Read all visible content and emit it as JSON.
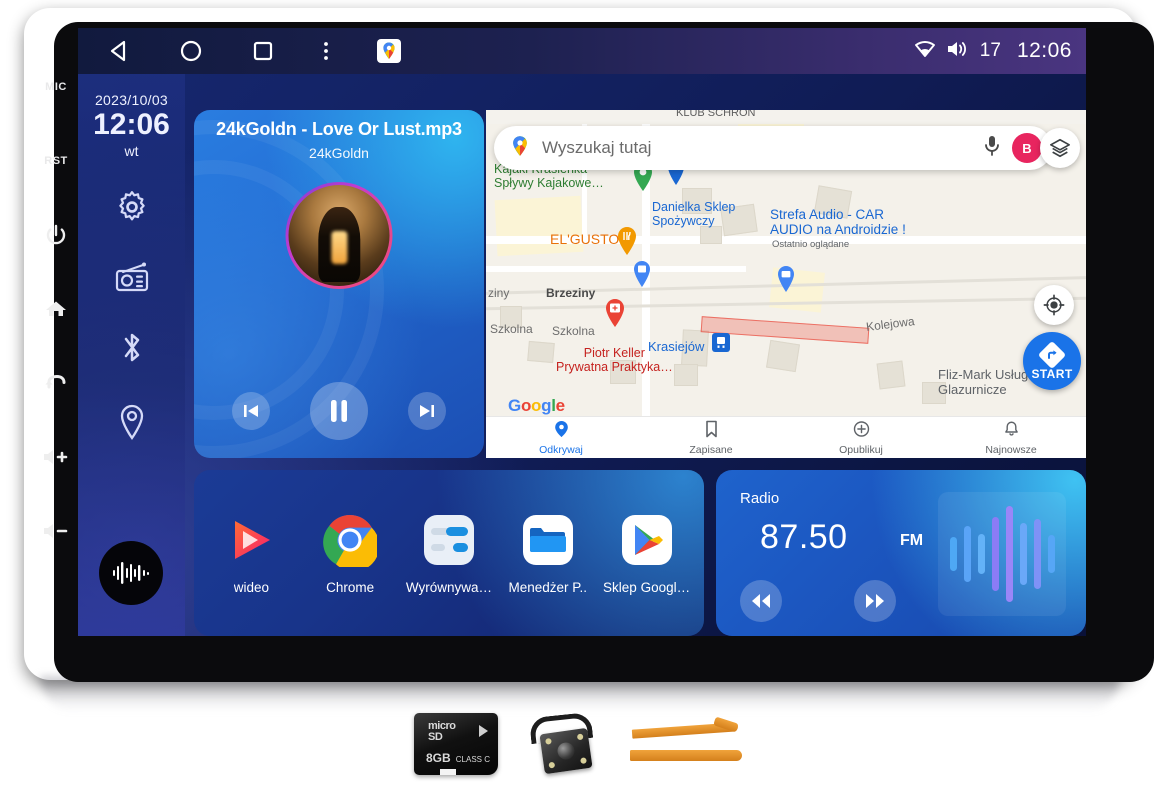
{
  "device": {
    "hardware_buttons": [
      {
        "name": "mic-button",
        "label": "MIC"
      },
      {
        "name": "reset-button",
        "label": "RST"
      },
      {
        "name": "power-button",
        "label": ""
      },
      {
        "name": "home-button",
        "label": ""
      },
      {
        "name": "back-button",
        "label": ""
      },
      {
        "name": "volume-up-button",
        "label": ""
      },
      {
        "name": "volume-down-button",
        "label": ""
      }
    ]
  },
  "statusbar": {
    "nav": [
      "back-icon",
      "home-icon",
      "recents-icon",
      "overflow-icon",
      "maps-icon"
    ],
    "volume_level": "17",
    "clock": "12:06",
    "wifi_icon": "wifi-icon",
    "volume_icon": "volume-icon"
  },
  "rail": {
    "date": "2023/10/03",
    "time": "12:06",
    "day_of_week": "wt",
    "icons": [
      {
        "name": "settings-icon",
        "label": "Ustawienia"
      },
      {
        "name": "radio-icon",
        "label": "Radio"
      },
      {
        "name": "bluetooth-icon",
        "label": "Bluetooth"
      },
      {
        "name": "navigation-icon",
        "label": "Nawigacja"
      }
    ],
    "visualizer_label": "music-visualizer"
  },
  "music": {
    "title": "24kGoldn - Love Or Lust.mp3",
    "artist": "24kGoldn",
    "prev_label": "previous-track",
    "play_label": "pause",
    "next_label": "next-track",
    "state": "playing"
  },
  "map": {
    "search_placeholder": "Wyszukaj tutaj",
    "search_value": "",
    "mic_icon": "microphone-icon",
    "avatar_initial": "B",
    "avatar_color": "#E8255F",
    "layers_icon": "layers-icon",
    "locate_icon": "my-location-icon",
    "start_label": "START",
    "top_clipped_text": "KLUB SCHRON",
    "pois": [
      {
        "name": "kajaki-poi",
        "text": "Kajaki Krasieńka -\nSpływy Kajakowe…",
        "color": "#2E7D32"
      },
      {
        "name": "danielka-poi",
        "text": "Danielka Sklep\nSpożywczy",
        "color": "#1967D2"
      },
      {
        "name": "strefa-audio-poi",
        "text": "Strefa Audio - CAR\nAUDIO na Androidzie !",
        "color": "#1967D2",
        "sub": "Ostatnio oglądane"
      },
      {
        "name": "elgusto-poi",
        "text": "EL'GUSTO",
        "color": "#E8710A"
      },
      {
        "name": "piotr-keller-poi",
        "text": "Piotr Keller\nPrywatna Praktyka…",
        "color": "#C5221F"
      },
      {
        "name": "krasiejow-poi",
        "text": "Krasiejów",
        "color": "#1967D2"
      },
      {
        "name": "fliz-mark-poi",
        "text": "Fliz-Mark Usługi\nGlazurnicze",
        "color": "#5F6368"
      }
    ],
    "street_labels": [
      "ziny",
      "Brzeziny",
      "Szkolna",
      "Szkolna",
      "Kolejowa"
    ],
    "brand": [
      "G",
      "o",
      "o",
      "g",
      "l",
      "e"
    ],
    "bottom_nav": [
      {
        "name": "map-tab-odkrywaj",
        "label": "Odkrywaj",
        "icon": "place-icon",
        "active": true
      },
      {
        "name": "map-tab-zapisane",
        "label": "Zapisane",
        "icon": "bookmark-icon",
        "active": false
      },
      {
        "name": "map-tab-opublikuj",
        "label": "Opublikuj",
        "icon": "plus-circle-icon",
        "active": false
      },
      {
        "name": "map-tab-najnowsze",
        "label": "Najnowsze",
        "icon": "bell-icon",
        "active": false
      }
    ]
  },
  "apps": [
    {
      "name": "app-wideo",
      "label": "wideo",
      "icon": "video-play-icon"
    },
    {
      "name": "app-chrome",
      "label": "Chrome",
      "icon": "chrome-icon"
    },
    {
      "name": "app-wyrownywanie",
      "label": "Wyrównywa…",
      "icon": "equalizer-icon"
    },
    {
      "name": "app-menedzer-plikow",
      "label": "Menedżer P..",
      "icon": "folder-icon"
    },
    {
      "name": "app-sklep-google-play",
      "label": "Sklep Googl…",
      "icon": "play-store-icon"
    }
  ],
  "radio": {
    "title": "Radio",
    "frequency": "87.50",
    "band": "FM",
    "prev_label": "seek-down",
    "next_label": "seek-up",
    "equalizer_icon": "equalizer-bars-icon",
    "bars": [
      34,
      56,
      40,
      74,
      96,
      62,
      70,
      38
    ]
  },
  "accessories": [
    {
      "name": "microsd-card",
      "brand": "micro",
      "brand2": "SD",
      "capacity": "8GB",
      "class": "CLASS C"
    },
    {
      "name": "rear-view-camera",
      "label": "rear-view-camera"
    },
    {
      "name": "pry-tools",
      "label": "plastic-pry-tools"
    }
  ]
}
